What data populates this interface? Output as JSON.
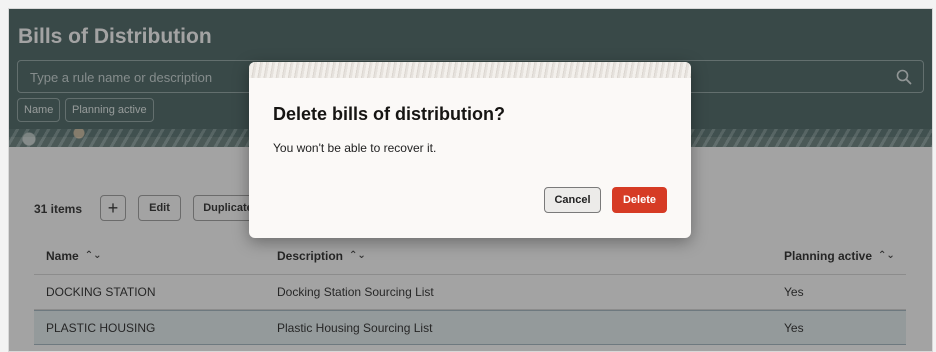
{
  "page": {
    "title": "Bills of Distribution",
    "search_placeholder": "Type a rule name or description",
    "filter_chips": [
      "Name",
      "Planning active"
    ]
  },
  "toolbar": {
    "items_count": "31 items",
    "add_label": "+",
    "edit_label": "Edit",
    "duplicate_label": "Duplicate"
  },
  "table": {
    "columns": [
      "Name",
      "Description",
      "Planning active"
    ],
    "rows": [
      {
        "name": "DOCKING STATION",
        "description": "Docking Station Sourcing List",
        "planning_active": "Yes"
      },
      {
        "name": "PLASTIC HOUSING",
        "description": "Plastic Housing Sourcing List",
        "planning_active": "Yes"
      }
    ],
    "selected_row_index": 1
  },
  "dialog": {
    "title": "Delete bills of distribution?",
    "message": "You won't be able to recover it.",
    "cancel_label": "Cancel",
    "delete_label": "Delete"
  },
  "icons": {
    "search": "search-icon",
    "sort": "sort-icon",
    "add": "plus-icon"
  },
  "colors": {
    "header_bg": "#3e5b5a",
    "delete_button": "#d63b25",
    "selected_row": "#e4eef0"
  }
}
